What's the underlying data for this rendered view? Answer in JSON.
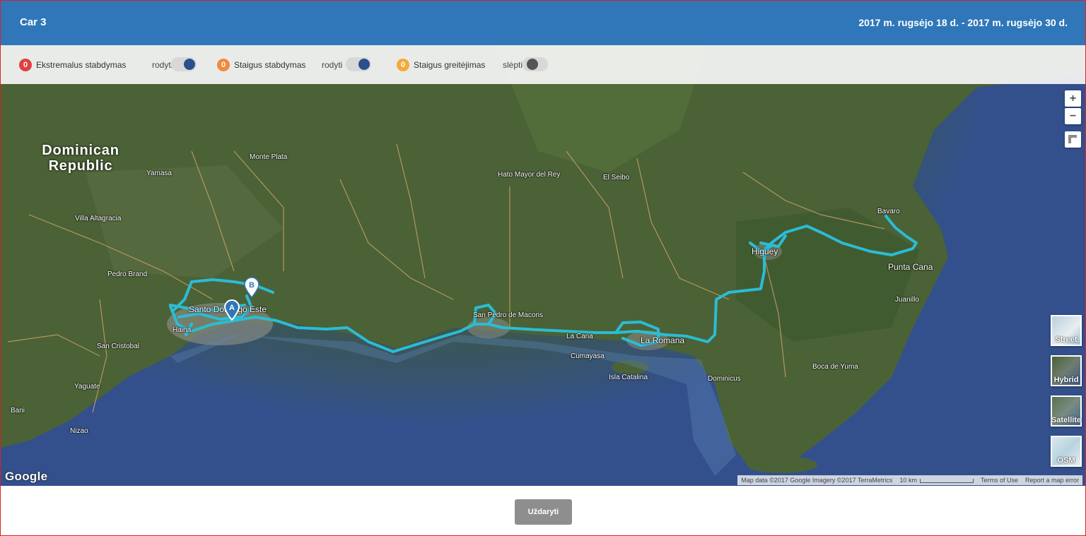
{
  "header": {
    "title": "Car 3",
    "date_range": "2017 m. rugsėjo 18 d. - 2017 m. rugsėjo 30 d."
  },
  "filters": [
    {
      "count": "0",
      "label": "Ekstremalus stabdymas",
      "toggle_label": "rodyti",
      "on": true,
      "color": "#e04040"
    },
    {
      "count": "0",
      "label": "Staigus stabdymas",
      "toggle_label": "rodyti",
      "on": true,
      "color": "#f28a3c"
    },
    {
      "count": "0",
      "label": "Staigus greitėjimas",
      "toggle_label": "slėpti",
      "on": false,
      "color": "#f5a93a"
    }
  ],
  "map": {
    "zoom_in": "+",
    "zoom_out": "−",
    "country_label": "Dominican Republic",
    "start_marker": "A",
    "end_marker": "B",
    "map_types": [
      "Street",
      "Hybrid",
      "Satellite",
      "OSM"
    ],
    "logo": "Google",
    "attribution": {
      "data": "Map data ©2017 Google Imagery ©2017 TerraMetrics",
      "scale": "10 km",
      "terms": "Terms of Use",
      "report": "Report a map error"
    },
    "places": [
      "Santo Domingo Este",
      "San Cristobal",
      "Bani",
      "La Romana",
      "Higuey",
      "Punta Cana",
      "Isla Catalina",
      "Dominicus",
      "Boca de Yuma",
      "San Pedro de Macoris",
      "El Seibo",
      "Hato Mayor del Rey",
      "Monte Plata",
      "Yamasa",
      "Villa Altagracia",
      "Pedro Brand",
      "Juanillo",
      "Bavaro",
      "Cumayasa",
      "La Cana",
      "Nizao",
      "Yaguate",
      "Haina"
    ],
    "route_color": "#2bbcd6",
    "marker_color": "#2f77b9"
  },
  "footer": {
    "close_label": "Uždaryti"
  }
}
